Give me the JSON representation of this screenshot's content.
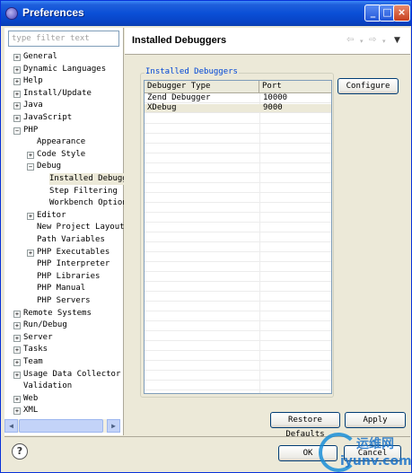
{
  "window": {
    "title": "Preferences"
  },
  "title_buttons": {
    "minimize": "_",
    "maximize": "□",
    "close": "×"
  },
  "filter": {
    "placeholder": "type filter text"
  },
  "tree": [
    {
      "label": "General",
      "level": 0,
      "expander": "+"
    },
    {
      "label": "Dynamic Languages",
      "level": 0,
      "expander": "+"
    },
    {
      "label": "Help",
      "level": 0,
      "expander": "+"
    },
    {
      "label": "Install/Update",
      "level": 0,
      "expander": "+"
    },
    {
      "label": "Java",
      "level": 0,
      "expander": "+"
    },
    {
      "label": "JavaScript",
      "level": 0,
      "expander": "+"
    },
    {
      "label": "PHP",
      "level": 0,
      "expander": "−"
    },
    {
      "label": "Appearance",
      "level": 1,
      "expander": ""
    },
    {
      "label": "Code Style",
      "level": 1,
      "expander": "+"
    },
    {
      "label": "Debug",
      "level": 1,
      "expander": "−"
    },
    {
      "label": "Installed Debuggers",
      "level": 2,
      "expander": "",
      "selected": true
    },
    {
      "label": "Step Filtering",
      "level": 2,
      "expander": ""
    },
    {
      "label": "Workbench Options",
      "level": 2,
      "expander": ""
    },
    {
      "label": "Editor",
      "level": 1,
      "expander": "+"
    },
    {
      "label": "New Project Layout",
      "level": 1,
      "expander": ""
    },
    {
      "label": "Path Variables",
      "level": 1,
      "expander": ""
    },
    {
      "label": "PHP Executables",
      "level": 1,
      "expander": "+"
    },
    {
      "label": "PHP Interpreter",
      "level": 1,
      "expander": ""
    },
    {
      "label": "PHP Libraries",
      "level": 1,
      "expander": ""
    },
    {
      "label": "PHP Manual",
      "level": 1,
      "expander": ""
    },
    {
      "label": "PHP Servers",
      "level": 1,
      "expander": ""
    },
    {
      "label": "Remote Systems",
      "level": 0,
      "expander": "+"
    },
    {
      "label": "Run/Debug",
      "level": 0,
      "expander": "+"
    },
    {
      "label": "Server",
      "level": 0,
      "expander": "+"
    },
    {
      "label": "Tasks",
      "level": 0,
      "expander": "+"
    },
    {
      "label": "Team",
      "level": 0,
      "expander": "+"
    },
    {
      "label": "Usage Data Collector",
      "level": 0,
      "expander": "+"
    },
    {
      "label": "Validation",
      "level": 0,
      "expander": ""
    },
    {
      "label": "Web",
      "level": 0,
      "expander": "+"
    },
    {
      "label": "XML",
      "level": 0,
      "expander": "+"
    }
  ],
  "page": {
    "title": "Installed Debuggers"
  },
  "nav_icons": {
    "back": "back-arrow-icon",
    "forward": "forward-arrow-icon",
    "menu": "view-menu-icon"
  },
  "group": {
    "label": "Installed Debuggers"
  },
  "table": {
    "columns": [
      "Debugger Type",
      "Port"
    ],
    "rows": [
      {
        "type": "Zend Debugger",
        "port": "10000"
      },
      {
        "type": "XDebug",
        "port": "9000",
        "selected": true
      }
    ]
  },
  "buttons": {
    "configure": "Configure",
    "restore_defaults": "Restore Defaults",
    "apply": "Apply",
    "ok": "OK",
    "cancel": "Cancel",
    "help": "?"
  },
  "watermark": {
    "line1": "运维网",
    "line2": "iyunv.com"
  },
  "colors": {
    "titlebar": "#0a4fd6",
    "group_label": "#0046d5",
    "selection": "#ece9d8"
  }
}
